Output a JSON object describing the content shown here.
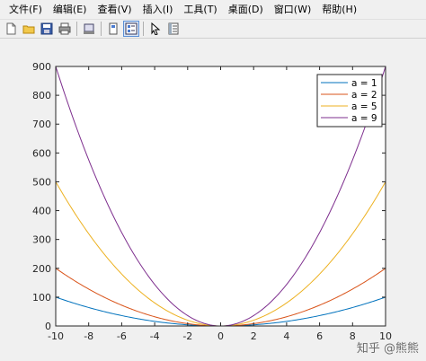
{
  "menubar": {
    "items": [
      {
        "label": "文件(F)"
      },
      {
        "label": "编辑(E)"
      },
      {
        "label": "查看(V)"
      },
      {
        "label": "插入(I)"
      },
      {
        "label": "工具(T)"
      },
      {
        "label": "桌面(D)"
      },
      {
        "label": "窗口(W)"
      },
      {
        "label": "帮助(H)"
      }
    ]
  },
  "toolbar": {
    "icons": [
      "new-file-icon",
      "open-folder-icon",
      "save-icon",
      "print-icon",
      "print-preview-icon",
      "link-icon",
      "plot-tools-icon",
      "pointer-icon",
      "property-editor-icon"
    ]
  },
  "watermark": {
    "text": "知乎 @熊熊"
  },
  "colors": {
    "a1": "#0072bd",
    "a2": "#d95319",
    "a5": "#edb120",
    "a9": "#7e2f8e"
  },
  "chart_data": {
    "type": "line",
    "title": "",
    "xlabel": "",
    "ylabel": "",
    "xlim": [
      -10,
      10
    ],
    "ylim": [
      0,
      900
    ],
    "xticks": [
      -10,
      -8,
      -6,
      -4,
      -2,
      0,
      2,
      4,
      6,
      8,
      10
    ],
    "yticks": [
      0,
      100,
      200,
      300,
      400,
      500,
      600,
      700,
      800,
      900
    ],
    "legend_position": "top-right",
    "grid": false,
    "series": [
      {
        "name": "a = 1",
        "a": 1,
        "color": "#0072bd"
      },
      {
        "name": "a = 2",
        "a": 2,
        "color": "#d95319"
      },
      {
        "name": "a = 5",
        "a": 5,
        "color": "#edb120"
      },
      {
        "name": "a = 9",
        "a": 9,
        "color": "#7e2f8e"
      }
    ],
    "x": [
      -10,
      -8,
      -6,
      -4,
      -2,
      0,
      2,
      4,
      6,
      8,
      10
    ]
  }
}
